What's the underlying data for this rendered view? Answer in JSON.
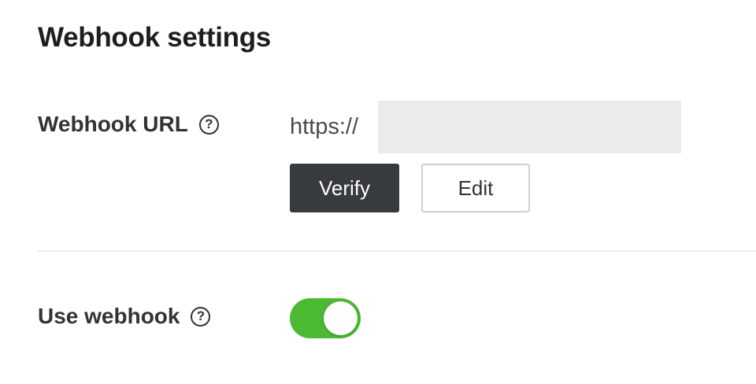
{
  "page_title": "Webhook settings",
  "webhook_url": {
    "label": "Webhook URL",
    "help_icon": "?",
    "value": "https://",
    "verify_label": "Verify",
    "edit_label": "Edit"
  },
  "use_webhook": {
    "label": "Use webhook",
    "help_icon": "?",
    "enabled": true,
    "on_color": "#4cb935"
  },
  "colors": {
    "primary_button": "#373a3f",
    "masked_area": "#ebebeb"
  }
}
